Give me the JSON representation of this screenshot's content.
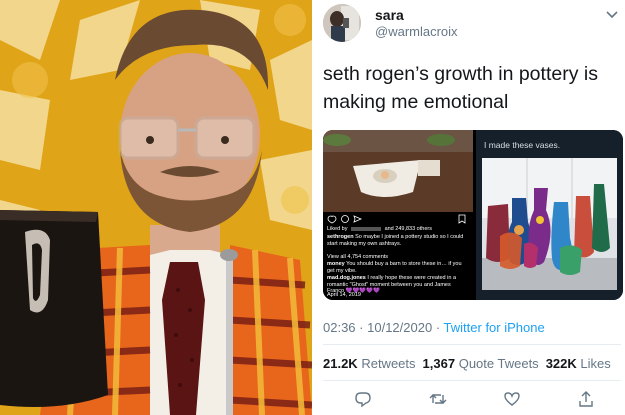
{
  "profile": {
    "display_name": "sara",
    "handle": "@warmlacroix"
  },
  "tweet": {
    "text": "seth rogen’s growth in pottery is making me emotional",
    "time": "02:36",
    "date": "10/12/2020",
    "source": "Twitter for iPhone"
  },
  "media": {
    "vases_caption": "I made these vases.",
    "ig_likes_prefix": "Liked by",
    "ig_likes_suffix": "and 249,833 others",
    "ig_user": "sethrogen",
    "ig_caption": "So maybe I joined a pottery studio so I could start making my own ashtrays.",
    "ig_view_all": "View all 4,754 comments",
    "ig_comment1_user": "money",
    "ig_comment1": "You should buy a barn to store these in… if you get my vibe.",
    "ig_comment2_user": "mad.dog.jones",
    "ig_comment2": "I really hope these were created in a romantic \"Ghost\" moment between you and James Franco",
    "ig_hearts": "💜💜💜💜💜",
    "ig_date": "April 14, 2019"
  },
  "stats": {
    "retweets_count": "21.2K",
    "retweets_label": "Retweets",
    "quotes_count": "1,367",
    "quotes_label": "Quote Tweets",
    "likes_count": "322K",
    "likes_label": "Likes"
  },
  "icons": {
    "actions": [
      "reply-icon",
      "retweet-icon",
      "like-icon",
      "share-icon"
    ]
  },
  "colors": {
    "link": "#1da1f2",
    "secondary_text": "#657786",
    "primary_text": "#14171a"
  }
}
